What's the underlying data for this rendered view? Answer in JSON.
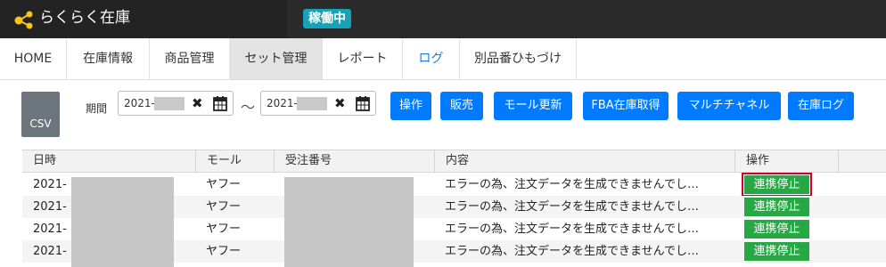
{
  "header": {
    "app_name": "らくらく在庫",
    "status": "稼働中",
    "brand_color": "#f5c518",
    "status_color": "#17a2b8"
  },
  "nav": {
    "items": [
      {
        "label": "HOME"
      },
      {
        "label": "在庫情報"
      },
      {
        "label": "商品管理"
      },
      {
        "label": "セット管理",
        "active": true
      },
      {
        "label": "レポート"
      },
      {
        "label": "ログ"
      },
      {
        "label": "別品番ひもづけ"
      }
    ]
  },
  "toolbar": {
    "csv_label": "CSV",
    "period_label": "期間",
    "date_from": "2021-",
    "date_to": "2021-",
    "separator": "～",
    "buttons": [
      "操作",
      "販売",
      "モール更新",
      "FBA在庫取得",
      "マルチチャネル",
      "在庫ログ"
    ],
    "button_color": "#007bff"
  },
  "table": {
    "headers": [
      "日時",
      "モール",
      "受注番号",
      "内容",
      "操作"
    ],
    "rows": [
      {
        "date": "2021-",
        "mall": "ヤフー",
        "content": "エラーの為、注文データを生成できませんでし…",
        "action": "連携停止"
      },
      {
        "date": "2021-",
        "mall": "ヤフー",
        "content": "エラーの為、注文データを生成できませんでし…",
        "action": "連携停止"
      },
      {
        "date": "2021-",
        "mall": "ヤフー",
        "content": "エラーの為、注文データを生成できませんでし…",
        "action": "連携停止"
      },
      {
        "date": "2021-",
        "mall": "ヤフー",
        "content": "エラーの為、注文データを生成できませんでし…",
        "action": "連携停止"
      }
    ],
    "action_color": "#28a745"
  }
}
